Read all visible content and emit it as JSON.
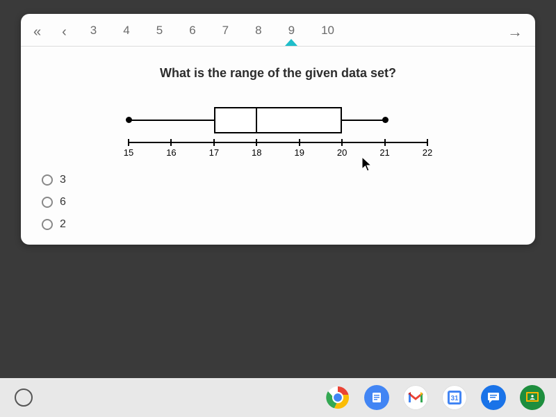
{
  "pager": {
    "first_label": "«",
    "prev_label": "‹",
    "pages": [
      "3",
      "4",
      "5",
      "6",
      "7",
      "8",
      "9",
      "10"
    ],
    "current_index": 6,
    "next_label": "→"
  },
  "question": "What is the range of the given data set?",
  "chart_data": {
    "type": "boxplot",
    "axis_ticks": [
      "15",
      "16",
      "17",
      "18",
      "19",
      "20",
      "21",
      "22"
    ],
    "min": 15,
    "q1": 17,
    "median": 18,
    "q3": 20,
    "max": 21,
    "xlim": [
      15,
      22
    ]
  },
  "options": [
    "3",
    "6",
    "2"
  ],
  "dock": {
    "items": [
      "launcher",
      "chrome",
      "docs",
      "gmail",
      "calendar",
      "messages",
      "classroom"
    ]
  }
}
